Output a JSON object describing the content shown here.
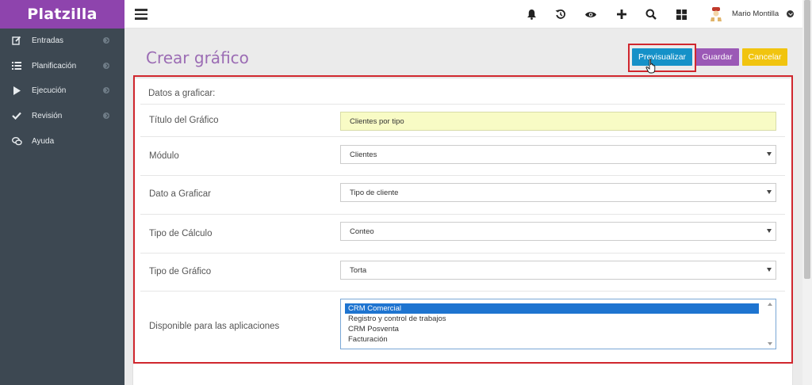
{
  "brand": "Platzilla",
  "sidebar": {
    "items": [
      {
        "label": "Entradas",
        "icon": "edit-icon",
        "has_chevron": true
      },
      {
        "label": "Planificación",
        "icon": "list-icon",
        "has_chevron": true
      },
      {
        "label": "Ejecución",
        "icon": "play-icon",
        "has_chevron": true
      },
      {
        "label": "Revisión",
        "icon": "check-icon",
        "has_chevron": true
      },
      {
        "label": "Ayuda",
        "icon": "chat-icon",
        "has_chevron": false
      }
    ]
  },
  "topbar": {
    "icons": [
      "bell-icon",
      "history-icon",
      "eye-icon",
      "plus-icon",
      "search-icon",
      "grid-icon"
    ],
    "user_name": "Mario Montilla"
  },
  "page": {
    "title": "Crear gráfico",
    "buttons": {
      "preview": "Previsualizar",
      "save": "Guardar",
      "cancel": "Cancelar"
    }
  },
  "form": {
    "section_title": "Datos a graficar:",
    "fields": {
      "titulo": {
        "label": "Título del Gráfico",
        "value": "Clientes por tipo"
      },
      "modulo": {
        "label": "Módulo",
        "value": "Clientes"
      },
      "dato": {
        "label": "Dato a Graficar",
        "value": "Tipo de cliente"
      },
      "calculo": {
        "label": "Tipo de Cálculo",
        "value": "Conteo"
      },
      "grafico": {
        "label": "Tipo de Gráfico",
        "value": "Torta"
      },
      "aplicaciones": {
        "label": "Disponible para las aplicaciones",
        "options": [
          "CRM Comercial",
          "Registro y control de trabajos",
          "CRM Posventa",
          "Facturación"
        ],
        "selected": "CRM Comercial"
      }
    }
  },
  "colors": {
    "brand": "#8e44ad",
    "sidebar": "#3d4852",
    "preview_button": "#1591c8",
    "save_button": "#9b59b6",
    "cancel_button": "#f1c40f",
    "highlight": "#d0272e",
    "title_input_bg": "#f8fbc5"
  }
}
